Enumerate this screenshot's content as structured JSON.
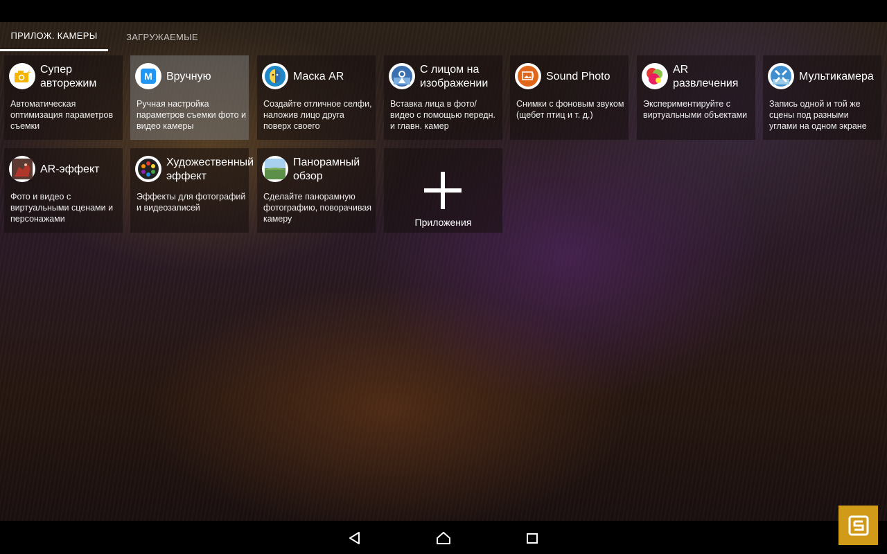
{
  "tabs": [
    {
      "label": "ПРИЛОЖ. КАМЕРЫ",
      "active": true
    },
    {
      "label": "ЗАГРУЖАЕМЫЕ",
      "active": false
    }
  ],
  "tiles": [
    {
      "title": "Супер авторежим",
      "desc": "Автоматическая оптимизация параметров съемки",
      "icon": "super-auto-camera-icon",
      "color": "#f4b400"
    },
    {
      "title": "Вручную",
      "desc": "Ручная настройка параметров съемки фото и видео камеры",
      "icon": "manual-m-icon",
      "color": "#2196f3",
      "selected": true
    },
    {
      "title": "Маска AR",
      "desc": "Создайте отличное селфи, наложив лицо друга поверх своего",
      "icon": "ar-mask-icon",
      "color": "#1e88c8"
    },
    {
      "title": "С лицом на изображении",
      "desc": "Вставка лица в фото/видео с помощью передн. и главн. камер",
      "icon": "face-in-picture-icon",
      "color": "#3a6fb0"
    },
    {
      "title": "Sound Photo",
      "desc": "Снимки с фоновым звуком (щебет птиц и т. д.)",
      "icon": "sound-photo-icon",
      "color": "#e0661a"
    },
    {
      "title": "AR развлечения",
      "desc": "Экспериментируйте с виртуальными объектами",
      "icon": "ar-fun-icon",
      "color": "#d23a6a"
    },
    {
      "title": "Мультикамера",
      "desc": "Запись одной и той же сцены под разными углами на одном экране",
      "icon": "multi-camera-icon",
      "color": "#3f8fd0"
    },
    {
      "title": "AR-эффект",
      "desc": "Фото и видео с виртуальными сценами и персонажами",
      "icon": "ar-effect-icon",
      "color": "#b0352a"
    },
    {
      "title": "Художественный эффект",
      "desc": "Эффекты для фотографий и видеозаписей",
      "icon": "creative-effect-icon",
      "color": "#222222"
    },
    {
      "title": "Панорамный обзор",
      "desc": "Сделайте панорамную фотографию, поворачивая камеру",
      "icon": "panorama-icon",
      "color": "#5c8f4a"
    }
  ],
  "apps_tile": {
    "label": "Приложения",
    "icon": "plus-icon"
  },
  "navbar": {
    "back_icon": "back-triangle-icon",
    "home_icon": "home-icon",
    "recents_icon": "recents-square-icon"
  },
  "badge": {
    "icon": "app-badge-icon",
    "color": "#d19a18"
  }
}
